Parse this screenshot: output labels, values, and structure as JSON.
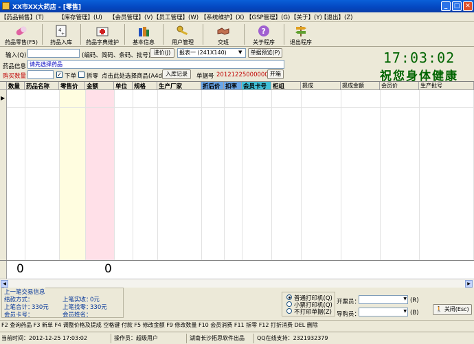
{
  "window": {
    "title": "XX市XX大药店 - [零售]",
    "min_label": "_",
    "max_label": "□",
    "close_label": "✕"
  },
  "menu": [
    "【药品销售】(T)",
    "【库存管理】(U)",
    "【会员管理】(V)",
    "【员工管理】(W)",
    "【系统维护】(X)",
    "【GSP管理】(G)",
    "【关于】(Y)",
    "【退出】(Z)"
  ],
  "toolbar": [
    {
      "label": "药品零售(F5)",
      "icon": "pill-icon"
    },
    {
      "label": "药品入库",
      "icon": "stock-in-icon"
    },
    {
      "label": "药品字典维护",
      "icon": "medicine-box-icon"
    },
    {
      "label": "基本信息",
      "icon": "bottles-icon"
    },
    {
      "label": "用户管理",
      "icon": "keys-icon"
    },
    {
      "label": "交班",
      "icon": "handshake-icon"
    },
    {
      "label": "关于程序",
      "icon": "help-icon"
    },
    {
      "label": "退出程序",
      "icon": "exit-sign-icon"
    }
  ],
  "input": {
    "label": "输入(Q)",
    "value": "",
    "hint": "(编码、简码、条码、批号)",
    "enter_button": "进价(J)",
    "report_select": "报表一 (241X140)",
    "preview_button": "单据预览(P)"
  },
  "drug_info": {
    "label": "药品信息",
    "value": "请先选择药品"
  },
  "purchase": {
    "label": "购买数量",
    "value": "",
    "order_label": "下单",
    "order_checked": true,
    "split_label": "拆零",
    "split_checked": false,
    "choose_hint": "点击此处选择商品(A4d)",
    "stock_record_button": "入库记录",
    "bill_no_label": "单据号",
    "bill_no": "2012122500000002",
    "open_box_button": "开箱"
  },
  "clock": {
    "time": "17:03:02",
    "wish": "祝您身体健康"
  },
  "grid": {
    "columns": [
      "数量",
      "药品名称",
      "零售价",
      "金额",
      "单位",
      "规格",
      "生产厂家",
      "折后价",
      "扣率",
      "会员卡号",
      "柜组",
      "提成",
      "提成金额",
      "会员价",
      "生产批号"
    ],
    "row_marker": "▶",
    "totals": {
      "quantity": "0",
      "amount": "0"
    }
  },
  "last_trade": {
    "legend": "上一笔交易信息",
    "pay_method_label": "结款方式：",
    "pay_method_value": "",
    "received_label": "上笔实收：",
    "received_value": "0元",
    "total_label": "上笔合计：",
    "total_value": "330元",
    "change_label": "上笔找零：",
    "change_value": "330元",
    "card_label": "会员卡号：",
    "card_value": "",
    "name_label": "会员姓名：",
    "name_value": ""
  },
  "printer": {
    "options": [
      "普通打印机(Q)",
      "小票打印机(Q)",
      "不打印单据(Z)"
    ],
    "selected": 0
  },
  "staff": {
    "issuer_label": "开票员：",
    "issuer_key": "(R)",
    "guide_label": "导购员：",
    "guide_key": "(B)",
    "close_button": "关闭(Esc)"
  },
  "shortcuts": "F2 查询药品 F3 新单  F4 调整价格及提成  空格键 付款 F5 修改金额   F9 修改数量 F10 会员消费 F11 拆零 F12 打折消费 DEL 删除",
  "status": {
    "time": "当前时间：2012-12-25  17:03:02",
    "operator": "操作员：超级用户",
    "company": "湖南长沙拓思软件出品",
    "support": "QQ在线支持：2321932379"
  },
  "colors": {
    "title_blue": "#0447c0",
    "clock_green": "#006400",
    "retail_col": "#fffde0",
    "amount_col": "#ffe0e8",
    "highlight_col": "#6aa6e8",
    "card_col": "#40c0d8"
  }
}
